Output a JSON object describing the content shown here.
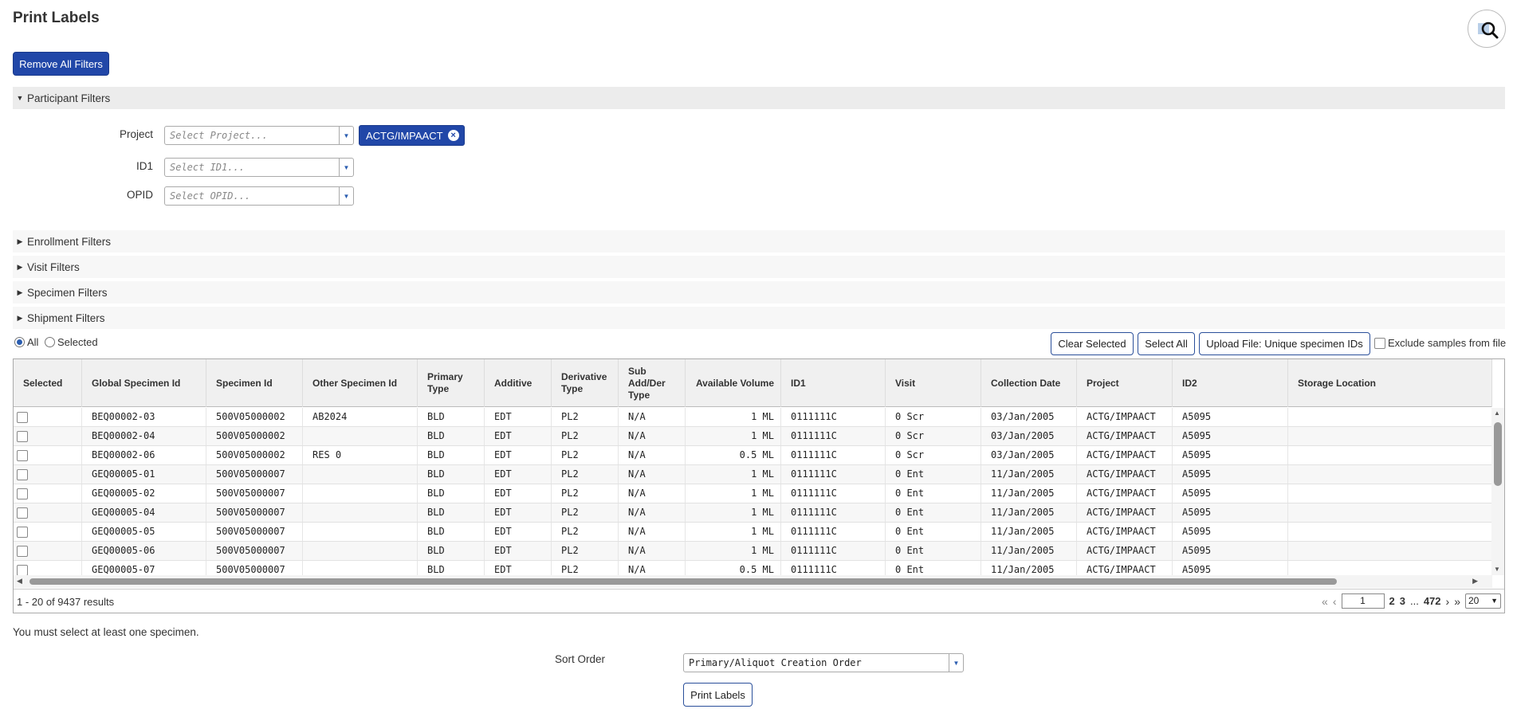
{
  "page": {
    "title": "Print Labels"
  },
  "toolbar": {
    "remove_filters": "Remove All Filters"
  },
  "sections": {
    "participant": "Participant Filters",
    "enrollment": "Enrollment Filters",
    "visit": "Visit Filters",
    "specimen": "Specimen Filters",
    "shipment": "Shipment Filters"
  },
  "filters": {
    "project": {
      "label": "Project",
      "placeholder": "Select Project...",
      "tag": "ACTG/IMPAACT"
    },
    "id1": {
      "label": "ID1",
      "placeholder": "Select ID1..."
    },
    "opid": {
      "label": "OPID",
      "placeholder": "Select OPID..."
    }
  },
  "selection": {
    "all_label": "All",
    "selected_label": "Selected",
    "mode": "All",
    "clear_selected": "Clear Selected",
    "select_all": "Select All",
    "upload": "Upload File: Unique specimen IDs",
    "exclude_label": "Exclude samples from file"
  },
  "table": {
    "columns": [
      "Selected",
      "Global Specimen Id",
      "Specimen Id",
      "Other Specimen Id",
      "Primary Type",
      "Additive",
      "Derivative Type",
      "Sub Add/Der Type",
      "Available Volume",
      "ID1",
      "Visit",
      "Collection Date",
      "Project",
      "ID2",
      "Storage Location"
    ],
    "rows": [
      [
        "BEQ00002-03",
        "500V05000002",
        "AB2024",
        "BLD",
        "EDT",
        "PL2",
        "N/A",
        "1 ML",
        "0111111C",
        "0 Scr",
        "03/Jan/2005",
        "ACTG/IMPAACT",
        "A5095",
        ""
      ],
      [
        "BEQ00002-04",
        "500V05000002",
        "",
        "BLD",
        "EDT",
        "PL2",
        "N/A",
        "1 ML",
        "0111111C",
        "0 Scr",
        "03/Jan/2005",
        "ACTG/IMPAACT",
        "A5095",
        ""
      ],
      [
        "BEQ00002-06",
        "500V05000002",
        "RES 0",
        "BLD",
        "EDT",
        "PL2",
        "N/A",
        "0.5 ML",
        "0111111C",
        "0 Scr",
        "03/Jan/2005",
        "ACTG/IMPAACT",
        "A5095",
        ""
      ],
      [
        "GEQ00005-01",
        "500V05000007",
        "",
        "BLD",
        "EDT",
        "PL2",
        "N/A",
        "1 ML",
        "0111111C",
        "0 Ent",
        "11/Jan/2005",
        "ACTG/IMPAACT",
        "A5095",
        ""
      ],
      [
        "GEQ00005-02",
        "500V05000007",
        "",
        "BLD",
        "EDT",
        "PL2",
        "N/A",
        "1 ML",
        "0111111C",
        "0 Ent",
        "11/Jan/2005",
        "ACTG/IMPAACT",
        "A5095",
        ""
      ],
      [
        "GEQ00005-04",
        "500V05000007",
        "",
        "BLD",
        "EDT",
        "PL2",
        "N/A",
        "1 ML",
        "0111111C",
        "0 Ent",
        "11/Jan/2005",
        "ACTG/IMPAACT",
        "A5095",
        ""
      ],
      [
        "GEQ00005-05",
        "500V05000007",
        "",
        "BLD",
        "EDT",
        "PL2",
        "N/A",
        "1 ML",
        "0111111C",
        "0 Ent",
        "11/Jan/2005",
        "ACTG/IMPAACT",
        "A5095",
        ""
      ],
      [
        "GEQ00005-06",
        "500V05000007",
        "",
        "BLD",
        "EDT",
        "PL2",
        "N/A",
        "1 ML",
        "0111111C",
        "0 Ent",
        "11/Jan/2005",
        "ACTG/IMPAACT",
        "A5095",
        ""
      ],
      [
        "GEQ00005-07",
        "500V05000007",
        "",
        "BLD",
        "EDT",
        "PL2",
        "N/A",
        "0.5 ML",
        "0111111C",
        "0 Ent",
        "11/Jan/2005",
        "ACTG/IMPAACT",
        "A5095",
        ""
      ]
    ]
  },
  "pagination": {
    "results": "1 - 20 of 9437 results",
    "first": "«",
    "prev": "‹",
    "current_page": "1",
    "page2": "2",
    "page3": "3",
    "ellipsis": "...",
    "last_page": "472",
    "next": "›",
    "last": "»",
    "page_size": "20"
  },
  "message": "You must select at least one specimen.",
  "sort": {
    "label": "Sort Order",
    "value": "Primary/Aliquot Creation Order"
  },
  "print_button": "Print Labels",
  "icons": {
    "search": "search-icon",
    "remove_tag": "close-circle-icon"
  },
  "colors": {
    "primary": "#2147a8",
    "outline": "#2a4f9a"
  }
}
